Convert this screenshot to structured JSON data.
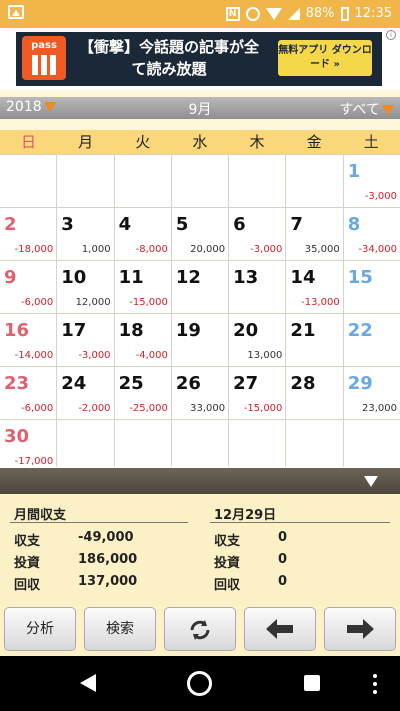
{
  "statusbar": {
    "battery": "88%",
    "time": "12:35"
  },
  "ad": {
    "headline": "【衝撃】今話題の記事が全て読み放題",
    "logo_text": "pass",
    "button": "無料アプリ ダウンロード »",
    "info": "i"
  },
  "header": {
    "year": "2018",
    "month": "9月",
    "filter": "すべて"
  },
  "weekdays": [
    "日",
    "月",
    "火",
    "水",
    "木",
    "金",
    "土"
  ],
  "calendar": [
    [
      {
        "d": ""
      },
      {
        "d": ""
      },
      {
        "d": ""
      },
      {
        "d": ""
      },
      {
        "d": ""
      },
      {
        "d": ""
      },
      {
        "d": "1",
        "a": "-3,000",
        "neg": true
      }
    ],
    [
      {
        "d": "2",
        "a": "-18,000",
        "neg": true
      },
      {
        "d": "3",
        "a": "1,000"
      },
      {
        "d": "4",
        "a": "-8,000",
        "neg": true
      },
      {
        "d": "5",
        "a": "20,000"
      },
      {
        "d": "6",
        "a": "-3,000",
        "neg": true
      },
      {
        "d": "7",
        "a": "35,000"
      },
      {
        "d": "8",
        "a": "-34,000",
        "neg": true
      }
    ],
    [
      {
        "d": "9",
        "a": "-6,000",
        "neg": true
      },
      {
        "d": "10",
        "a": "12,000"
      },
      {
        "d": "11",
        "a": "-15,000",
        "neg": true
      },
      {
        "d": "12"
      },
      {
        "d": "13"
      },
      {
        "d": "14",
        "a": "-13,000",
        "neg": true
      },
      {
        "d": "15"
      }
    ],
    [
      {
        "d": "16",
        "a": "-14,000",
        "neg": true
      },
      {
        "d": "17",
        "a": "-3,000",
        "neg": true
      },
      {
        "d": "18",
        "a": "-4,000",
        "neg": true
      },
      {
        "d": "19"
      },
      {
        "d": "20",
        "a": "13,000"
      },
      {
        "d": "21"
      },
      {
        "d": "22"
      }
    ],
    [
      {
        "d": "23",
        "a": "-6,000",
        "neg": true
      },
      {
        "d": "24",
        "a": "-2,000",
        "neg": true
      },
      {
        "d": "25",
        "a": "-25,000",
        "neg": true
      },
      {
        "d": "26",
        "a": "33,000"
      },
      {
        "d": "27",
        "a": "-15,000",
        "neg": true
      },
      {
        "d": "28"
      },
      {
        "d": "29",
        "a": "23,000"
      }
    ],
    [
      {
        "d": "30",
        "a": "-17,000",
        "neg": true
      },
      {
        "d": ""
      },
      {
        "d": ""
      },
      {
        "d": ""
      },
      {
        "d": ""
      },
      {
        "d": ""
      },
      {
        "d": ""
      }
    ]
  ],
  "summary": {
    "monthly_title": "月間収支",
    "date_title": "12月29日",
    "labels": {
      "balance": "収支",
      "invest": "投資",
      "return": "回収"
    },
    "monthly": {
      "balance": "-49,000",
      "invest": "186,000",
      "return": "137,000"
    },
    "daily": {
      "balance": "0",
      "invest": "0",
      "return": "0"
    }
  },
  "buttons": {
    "analysis": "分析",
    "search": "検索"
  }
}
